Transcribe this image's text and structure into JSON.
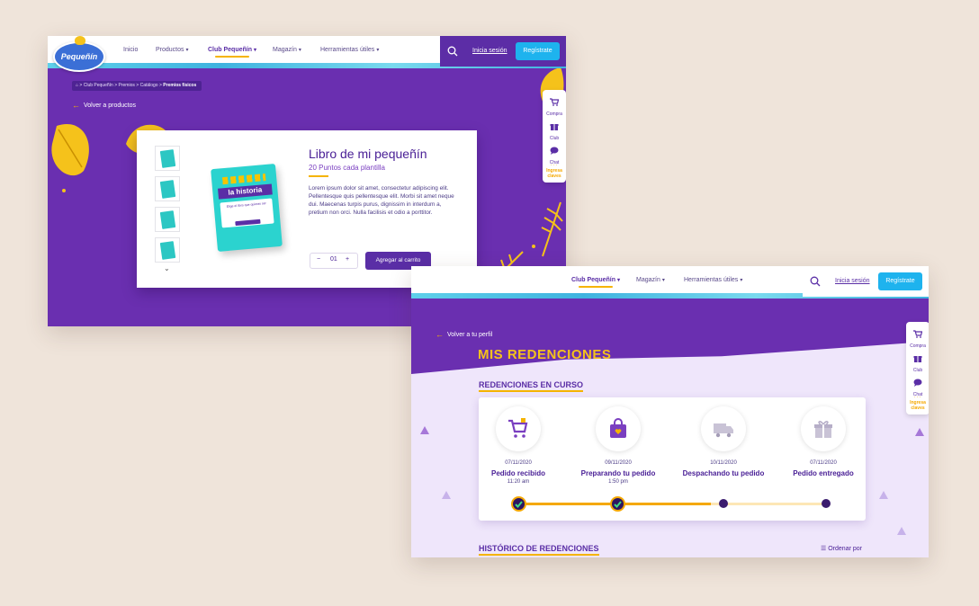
{
  "colors": {
    "brand_purple": "#6a2fb0",
    "deep_purple": "#5c2da6",
    "accent_yellow": "#f5b400",
    "cta_blue": "#1eb3ee",
    "bg": "#efe4da"
  },
  "logo": {
    "text": "Pequeñín"
  },
  "nav": {
    "items": [
      "Inicio",
      "Productos",
      "Club Pequeñín",
      "Magazín",
      "Herramientas útiles"
    ],
    "active": "Club Pequeñín",
    "login": "Inicia sesión",
    "register": "Regístrate"
  },
  "side_widget": {
    "items": [
      "Compra",
      "Club",
      "Chat"
    ],
    "last": "Ingresa claves"
  },
  "product_page": {
    "breadcrumb": [
      "Club Pequeñín",
      "Premios",
      "Catálogo",
      "Premios físicos"
    ],
    "back_label": "Volver a productos",
    "title": "Libro de mi pequeñín",
    "points": "20 Puntos cada plantilla",
    "description": "Lorem ipsum dolor sit amet, consectetur adipiscing elit. Pellentesque quis pellentesque elit. Morbi sit amet neque dui. Maecenas turpis purus, dignissim in interdum a, pretium non orci. Nulla facilisis et odio a porttitor.",
    "quantity": "01",
    "add_to_cart": "Agregar al carrito",
    "book_cover_title": "la historia",
    "book_cover_caption": "Elige el libro que quieras ser"
  },
  "redemptions_page": {
    "back_label": "Volver a tu perfil",
    "title": "MIS REDENCIONES",
    "in_progress_title": "REDENCIONES EN CURSO",
    "history_title": "HISTÓRICO DE REDENCIONES",
    "sort_label": "Ordenar por",
    "progress_fraction": 0.62,
    "steps": [
      {
        "date": "07/11/2020",
        "name": "Pedido recibido",
        "time": "11:20 am",
        "status": "done",
        "icon": "cart-icon"
      },
      {
        "date": "09/11/2020",
        "name": "Preparando tu pedido",
        "time": "1:50 pm",
        "status": "done",
        "icon": "bag-icon"
      },
      {
        "date": "10/11/2020",
        "name": "Despachando tu pedido",
        "time": "",
        "status": "pending",
        "icon": "truck-icon"
      },
      {
        "date": "07/11/2020",
        "name": "Pedido entregado",
        "time": "",
        "status": "pending",
        "icon": "gift-icon"
      }
    ]
  }
}
